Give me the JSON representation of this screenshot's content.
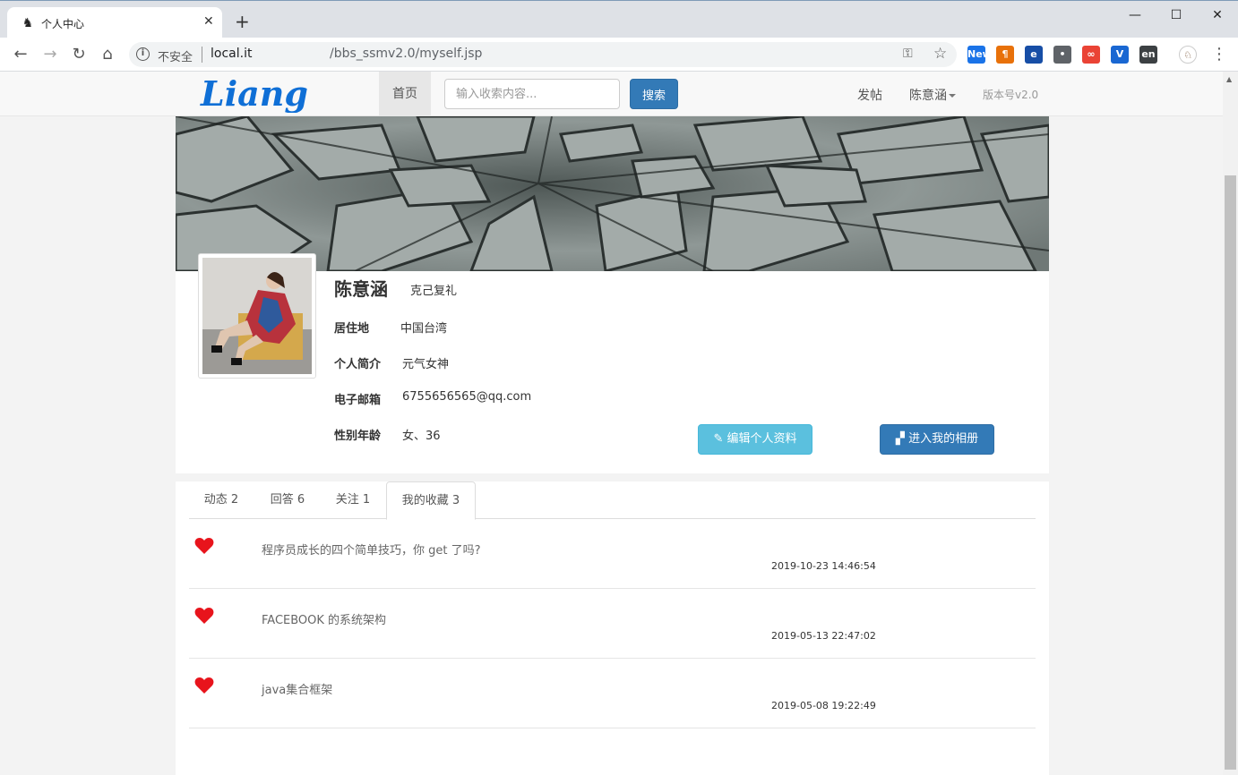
{
  "browser": {
    "tab_title": "个人中心",
    "insecure_label": "不安全",
    "url_host": "local.it",
    "url_path": "/bbs_ssmv2.0/myself.jsp",
    "extensions": [
      {
        "name": "new-extension",
        "label": "New",
        "color": "#1a73e8"
      },
      {
        "name": "pilcrow-extension",
        "label": "¶",
        "color": "#e8710a"
      },
      {
        "name": "e-extension",
        "label": "e",
        "color": "#174ea6"
      },
      {
        "name": "bulb-extension",
        "label": "•",
        "color": "#5f6368"
      },
      {
        "name": "infinity-extension",
        "label": "∞",
        "color": "#ea4335"
      },
      {
        "name": "v-extension",
        "label": "V",
        "color": "#1967d2"
      },
      {
        "name": "en-extension",
        "label": "en",
        "color": "#3c4043"
      }
    ]
  },
  "navbar": {
    "logo_text": "Liang",
    "home": "首页",
    "search_placeholder": "输入收索内容...",
    "search_button": "搜索",
    "post": "发帖",
    "user": "陈意涵",
    "version": "版本号v2.0"
  },
  "profile": {
    "name": "陈意涵",
    "motto": "克己复礼",
    "fields": [
      {
        "label": "居住地",
        "value": "中国台湾"
      },
      {
        "label": "个人简介",
        "value": "元气女神"
      },
      {
        "label": "电子邮箱",
        "value": "6755656565@qq.com"
      },
      {
        "label": "性别年龄",
        "value": "女、36"
      }
    ],
    "edit_button": "编辑个人资料",
    "album_button": "进入我的相册"
  },
  "tabs": [
    {
      "label": "动态 2",
      "active": false
    },
    {
      "label": "回答 6",
      "active": false
    },
    {
      "label": "关注 1",
      "active": false
    },
    {
      "label": "我的收藏 3",
      "active": true
    }
  ],
  "favorites": [
    {
      "title": "程序员成长的四个简单技巧，你 get 了吗?",
      "time": "2019-10-23 14:46:54"
    },
    {
      "title": "FACEBOOK 的系统架构",
      "time": "2019-05-13 22:47:02"
    },
    {
      "title": "java集合框架",
      "time": "2019-05-08 19:22:49"
    }
  ],
  "colors": {
    "primary": "#337ab7",
    "info": "#5bc0de",
    "heart": "#e8141c"
  }
}
